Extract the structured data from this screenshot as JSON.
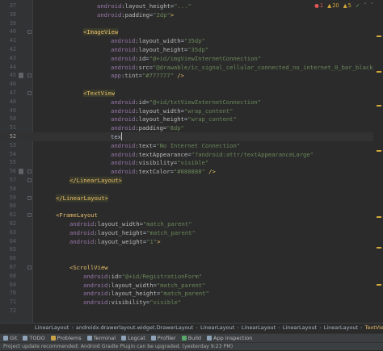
{
  "editor": {
    "lines": [
      {
        "n": "37",
        "parts": [
          [
            "attr-ns",
            "android"
          ],
          [
            "attr",
            ":layout_height"
          ],
          [
            "plain",
            "="
          ],
          [
            "val",
            "\"...\""
          ]
        ]
      },
      {
        "n": "38",
        "parts": [
          [
            "attr-ns",
            "android"
          ],
          [
            "attr",
            ":padding"
          ],
          [
            "plain",
            "="
          ],
          [
            "val",
            "\"2dp\""
          ],
          [
            "punct",
            ">"
          ]
        ]
      },
      {
        "n": "39",
        "parts": []
      },
      {
        "n": "40",
        "parts": [
          [
            "tag-hl",
            "<ImageView"
          ]
        ]
      },
      {
        "n": "41",
        "parts": [
          [
            "attr-ns",
            "android"
          ],
          [
            "attr",
            ":layout_width"
          ],
          [
            "plain",
            "="
          ],
          [
            "val",
            "\"35dp\""
          ]
        ]
      },
      {
        "n": "42",
        "parts": [
          [
            "attr-ns",
            "android"
          ],
          [
            "attr",
            ":layout_height"
          ],
          [
            "plain",
            "="
          ],
          [
            "val",
            "\"35dp\""
          ]
        ]
      },
      {
        "n": "43",
        "parts": [
          [
            "attr-ns",
            "android"
          ],
          [
            "attr",
            ":id"
          ],
          [
            "plain",
            "="
          ],
          [
            "val",
            "\"@+id/imgViewInternetConnection\""
          ]
        ]
      },
      {
        "n": "44",
        "parts": [
          [
            "attr-ns",
            "android"
          ],
          [
            "attr",
            ":src"
          ],
          [
            "plain",
            "="
          ],
          [
            "val",
            "\"@drawable/ic_signal_cellular_connected_no_internet_0_bar_black_48dp\""
          ]
        ]
      },
      {
        "n": "45",
        "parts": [
          [
            "attr-ns",
            "app"
          ],
          [
            "attr",
            ":tint"
          ],
          [
            "plain",
            "="
          ],
          [
            "val",
            "\"#777777\""
          ],
          [
            "punct",
            " />"
          ]
        ]
      },
      {
        "n": "46",
        "parts": []
      },
      {
        "n": "47",
        "parts": [
          [
            "tag-hl",
            "<TextView"
          ]
        ]
      },
      {
        "n": "48",
        "parts": [
          [
            "attr-ns",
            "android"
          ],
          [
            "attr",
            ":id"
          ],
          [
            "plain",
            "="
          ],
          [
            "val",
            "\"@+id/txtViewInternetConnection\""
          ]
        ]
      },
      {
        "n": "49",
        "parts": [
          [
            "attr-ns",
            "android"
          ],
          [
            "attr",
            ":layout_width"
          ],
          [
            "plain",
            "="
          ],
          [
            "val",
            "\"wrap_content\""
          ]
        ]
      },
      {
        "n": "50",
        "parts": [
          [
            "attr-ns",
            "android"
          ],
          [
            "attr",
            ":layout_height"
          ],
          [
            "plain",
            "="
          ],
          [
            "val",
            "\"wrap_content\""
          ]
        ]
      },
      {
        "n": "51",
        "parts": [
          [
            "attr-ns",
            "android"
          ],
          [
            "attr",
            ":padding"
          ],
          [
            "plain",
            "="
          ],
          [
            "val",
            "\"8dp\""
          ]
        ]
      },
      {
        "n": "52",
        "parts": [
          [
            "plain",
            "tex"
          ]
        ]
      },
      {
        "n": "53",
        "parts": [
          [
            "attr-ns",
            "android"
          ],
          [
            "attr",
            ":text"
          ],
          [
            "plain",
            "="
          ],
          [
            "val",
            "\"No Internet Connection\""
          ]
        ]
      },
      {
        "n": "54",
        "parts": [
          [
            "attr-ns",
            "android"
          ],
          [
            "attr",
            ":textAppearance"
          ],
          [
            "plain",
            "="
          ],
          [
            "val",
            "\"?android:attr/textAppearanceLarge\""
          ]
        ]
      },
      {
        "n": "55",
        "parts": [
          [
            "attr-ns",
            "android"
          ],
          [
            "attr",
            ":visibility"
          ],
          [
            "plain",
            "="
          ],
          [
            "val",
            "\"visible\""
          ]
        ]
      },
      {
        "n": "56",
        "parts": [
          [
            "attr-ns",
            "android"
          ],
          [
            "attr",
            ":textColor"
          ],
          [
            "plain",
            "="
          ],
          [
            "val",
            "\"#888888\""
          ],
          [
            "punct",
            " />"
          ]
        ]
      },
      {
        "n": "57",
        "parts": [
          [
            "tag-hl",
            "</LinearLayout>"
          ]
        ]
      },
      {
        "n": "58",
        "parts": []
      },
      {
        "n": "59",
        "parts": [
          [
            "tag-hl",
            "</LinearLayout>"
          ]
        ]
      },
      {
        "n": "60",
        "parts": []
      },
      {
        "n": "61",
        "parts": [
          [
            "tag",
            "<FrameLayout"
          ]
        ]
      },
      {
        "n": "62",
        "parts": [
          [
            "attr-ns",
            "android"
          ],
          [
            "attr",
            ":layout_width"
          ],
          [
            "plain",
            "="
          ],
          [
            "val",
            "\"match_parent\""
          ]
        ]
      },
      {
        "n": "63",
        "parts": [
          [
            "attr-ns",
            "android"
          ],
          [
            "attr",
            ":layout_height"
          ],
          [
            "plain",
            "="
          ],
          [
            "val",
            "\"match_parent\""
          ]
        ]
      },
      {
        "n": "64",
        "parts": [
          [
            "attr-ns",
            "android"
          ],
          [
            "attr",
            ":layout_weight"
          ],
          [
            "plain",
            "="
          ],
          [
            "val",
            "\"1\""
          ],
          [
            "punct",
            ">"
          ]
        ]
      },
      {
        "n": "65",
        "parts": []
      },
      {
        "n": "66",
        "parts": []
      },
      {
        "n": "67",
        "parts": [
          [
            "tag",
            "<ScrollView"
          ]
        ]
      },
      {
        "n": "68",
        "parts": [
          [
            "attr-ns",
            "android"
          ],
          [
            "attr",
            ":id"
          ],
          [
            "plain",
            "="
          ],
          [
            "val",
            "\"@+id/RegistrationForm\""
          ]
        ]
      },
      {
        "n": "69",
        "parts": [
          [
            "attr-ns",
            "android"
          ],
          [
            "attr",
            ":layout_width"
          ],
          [
            "plain",
            "="
          ],
          [
            "val",
            "\"match_parent\""
          ]
        ]
      },
      {
        "n": "70",
        "parts": [
          [
            "attr-ns",
            "android"
          ],
          [
            "attr",
            ":layout_height"
          ],
          [
            "plain",
            "="
          ],
          [
            "val",
            "\"match_parent\""
          ]
        ]
      },
      {
        "n": "71",
        "parts": [
          [
            "attr-ns",
            "android"
          ],
          [
            "attr",
            ":visibility"
          ],
          [
            "plain",
            "="
          ],
          [
            "val",
            "\"visible\""
          ]
        ]
      },
      {
        "n": "72",
        "parts": []
      }
    ],
    "current_line": "52"
  },
  "inspections": {
    "errors": "1",
    "warnings": "20",
    "weak_warnings": "5"
  },
  "breadcrumb": [
    "LinearLayout",
    "androidx.drawerlayout.widget.DrawerLayout",
    "LinearLayout",
    "LinearLayout",
    "LinearLayout",
    "LinearLayout",
    "TextView"
  ],
  "toolbar": [
    {
      "label": "Git",
      "icon": "git-branch-icon"
    },
    {
      "label": "TODO",
      "icon": "todo-list-icon"
    },
    {
      "label": "Problems",
      "icon": "problems-icon"
    },
    {
      "label": "Terminal",
      "icon": "terminal-icon"
    },
    {
      "label": "Logcat",
      "icon": "logcat-icon"
    },
    {
      "label": "Profiler",
      "icon": "profiler-icon"
    },
    {
      "label": "Build",
      "icon": "build-hammer-icon"
    },
    {
      "label": "App Inspection",
      "icon": "app-inspection-icon"
    }
  ],
  "status": {
    "message": "Project update recommended: Android Gradle Plugin can be upgraded. (yesterday 9:23 PM)"
  },
  "colors": {
    "error": "#e05555",
    "warning": "#d4a93a",
    "ok": "#59a869",
    "tag": "#e8bf6a",
    "value": "#6a8759",
    "namespace": "#9876aa"
  }
}
